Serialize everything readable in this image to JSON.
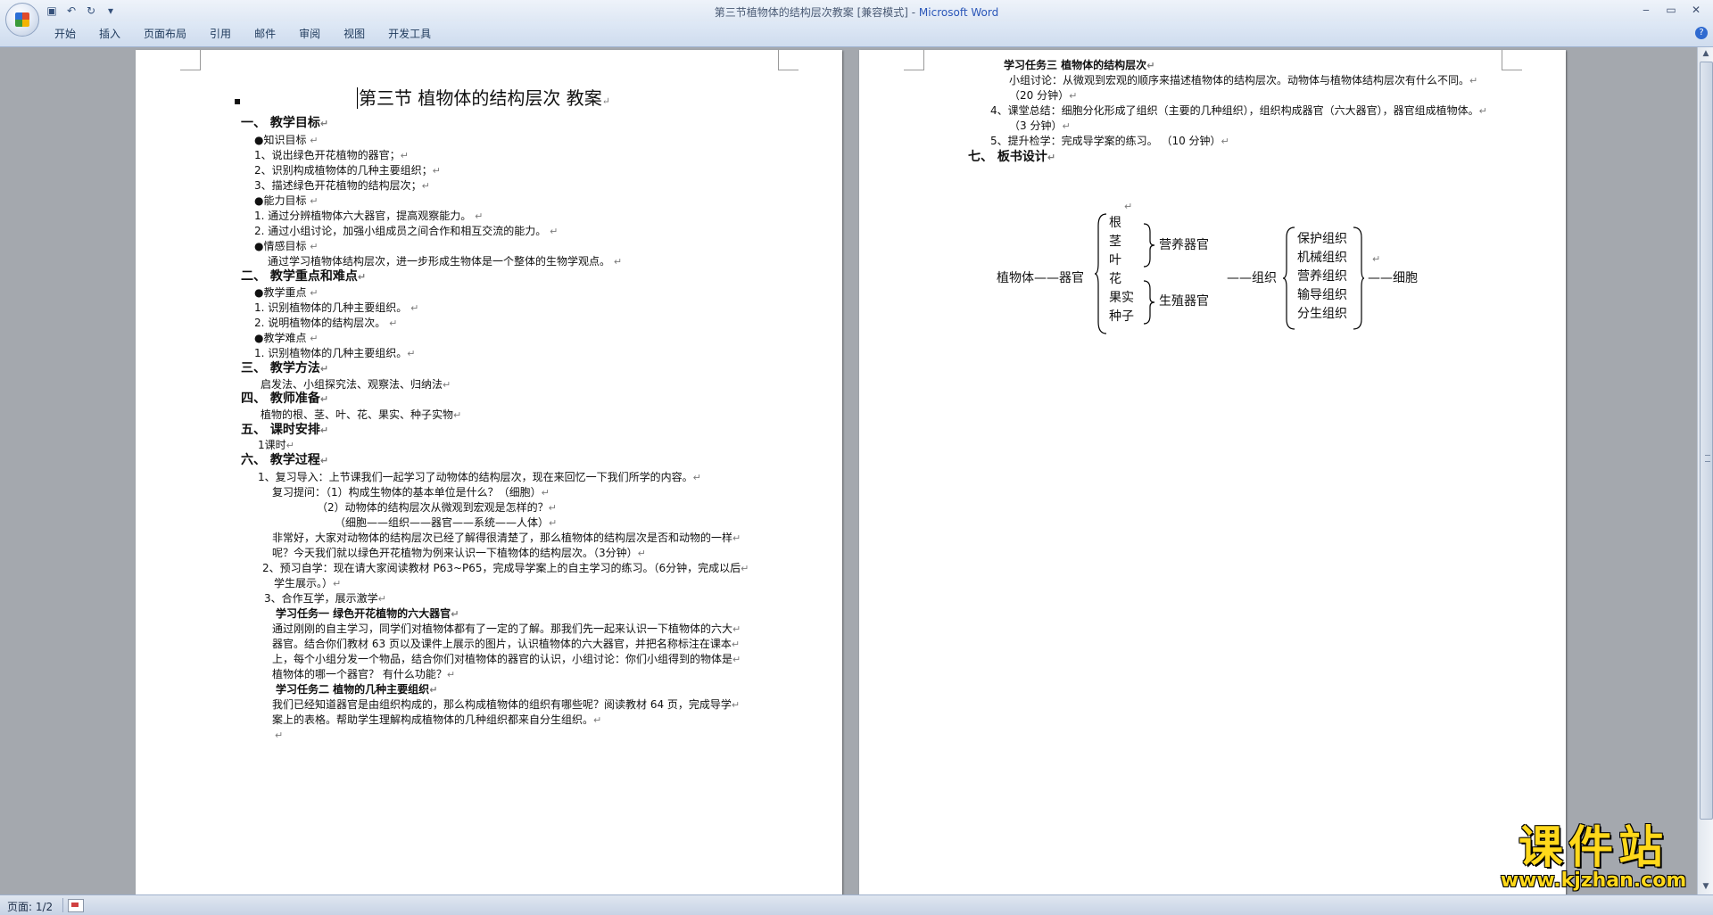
{
  "window": {
    "title": "第三节植物体的结构层次教案 [兼容模式] - ",
    "app_name": "Microsoft Word",
    "minimize": "‒",
    "maximize": "▭",
    "close": "✕"
  },
  "qat": {
    "save_icon": "▣",
    "undo_icon": "↶",
    "redo_icon": "↻",
    "more_icon": "▾"
  },
  "tabs": [
    "开始",
    "插入",
    "页面布局",
    "引用",
    "邮件",
    "审阅",
    "视图",
    "开发工具"
  ],
  "help_icon": "?",
  "page1": {
    "bullet": "▪",
    "title": "第三节  植物体的结构层次    教案",
    "lines": [
      {
        "t": "一、      教学目标",
        "h": true
      },
      {
        "t": "●知识目标  "
      },
      {
        "t": "1、说出绿色开花植物的器官；"
      },
      {
        "t": "2、识别构成植物体的几种主要组织；"
      },
      {
        "t": "3、描述绿色开花植物的结构层次；"
      },
      {
        "t": "●能力目标  "
      },
      {
        "t": "1. 通过分辨植物体六大器官，提高观察能力。  "
      },
      {
        "t": "2. 通过小组讨论，加强小组成员之间合作和相互交流的能力。  "
      },
      {
        "t": "●情感目标  "
      },
      {
        "t": "通过学习植物体结构层次，进一步形成生物体是一个整体的生物学观点。  "
      },
      {
        "t": "二、      教学重点和难点",
        "h": true
      },
      {
        "t": "●教学重点  "
      },
      {
        "t": "1. 识别植物体的几种主要组织。  "
      },
      {
        "t": "2. 说明植物体的结构层次。  "
      },
      {
        "t": "●教学难点  "
      },
      {
        "t": "1. 识别植物体的几种主要组织。"
      },
      {
        "t": "三、      教学方法",
        "h": true
      },
      {
        "t": "启发法、小组探究法、观察法、归纳法"
      },
      {
        "t": "四、      教师准备",
        "h": true
      },
      {
        "t": "植物的根、茎、叶、花、果实、种子实物"
      },
      {
        "t": "五、      课时安排",
        "h": true
      },
      {
        "t": "1课时"
      },
      {
        "t": "六、      教学过程",
        "h": true
      },
      {
        "t": "1、复习导入：上节课我们一起学习了动物体的结构层次，现在来回忆一下我们所学的内容。"
      },
      {
        "t": "复习提问：（1）构成生物体的基本单位是什么？（细胞）"
      },
      {
        "t": "（2）动物体的结构层次从微观到宏观是怎样的？"
      },
      {
        "t": "（细胞——组织——器官——系统——人体）"
      },
      {
        "t": "非常好，大家对动物体的结构层次已经了解得很清楚了，那么植物体的结构层次是否和动物的一样"
      },
      {
        "t": "呢？今天我们就以绿色开花植物为例来认识一下植物体的结构层次。（3分钟）"
      },
      {
        "t": "2、预习自学：现在请大家阅读教材 P63~P65，完成导学案上的自主学习的练习。（6分钟，完成以后"
      },
      {
        "t": "学生展示。）"
      },
      {
        "t": "3、合作互学，展示激学"
      },
      {
        "t": "学习任务一    绿色开花植物的六大器官",
        "b": true
      },
      {
        "t": "通过刚刚的自主学习，同学们对植物体都有了一定的了解。那我们先一起来认识一下植物体的六大"
      },
      {
        "t": "器官。结合你们教材 63 页以及课件上展示的图片，认识植物体的六大器官，并把名称标注在课本"
      },
      {
        "t": "上，每个小组分发一个物品，结合你们对植物体的器官的认识，小组讨论：你们小组得到的物体是"
      },
      {
        "t": "植物体的哪一个器官？ 有什么功能？"
      },
      {
        "t": "学习任务二    植物的几种主要组织",
        "b": true
      },
      {
        "t": "我们已经知道器官是由组织构成的，那么构成植物体的组织有哪些呢？阅读教材 64 页，完成导学"
      },
      {
        "t": "案上的表格。帮助学生理解构成植物体的几种组织都来自分生组织。"
      },
      {
        "t": ""
      }
    ]
  },
  "page2": {
    "lines": [
      {
        "t": "学习任务三    植物体的结构层次",
        "b": true
      },
      {
        "t": "小组讨论：从微观到宏观的顺序来描述植物体的结构层次。动物体与植物体结构层次有什么不同。"
      },
      {
        "t": "（20 分钟）"
      },
      {
        "t": "4、课堂总结：细胞分化形成了组织（主要的几种组织），组织构成器官（六大器官），器官组成植物体。"
      },
      {
        "t": "（3 分钟）"
      },
      {
        "t": "5、提升检学：完成导学案的练习。 （10 分钟）"
      },
      {
        "t": "七、    板书设计",
        "h": true
      }
    ],
    "diagram": {
      "plant": "植物体——器官",
      "organs": [
        "根",
        "茎",
        "叶",
        "花",
        "果实",
        "种子"
      ],
      "vegetative": "营养器官",
      "reproductive": "生殖器官",
      "tissue_link": "——组织",
      "tissues": [
        "保护组织",
        "机械组织",
        "营养组织",
        "输导组织",
        "分生组织"
      ],
      "cell_link": "——细胞"
    }
  },
  "paragraph_mark": "↵",
  "status": {
    "page": "页面: 1/2"
  },
  "watermark": {
    "main": "课件站",
    "url": "www.kjzhan.com"
  },
  "scroll": {
    "up": "▲",
    "down": "▼"
  }
}
